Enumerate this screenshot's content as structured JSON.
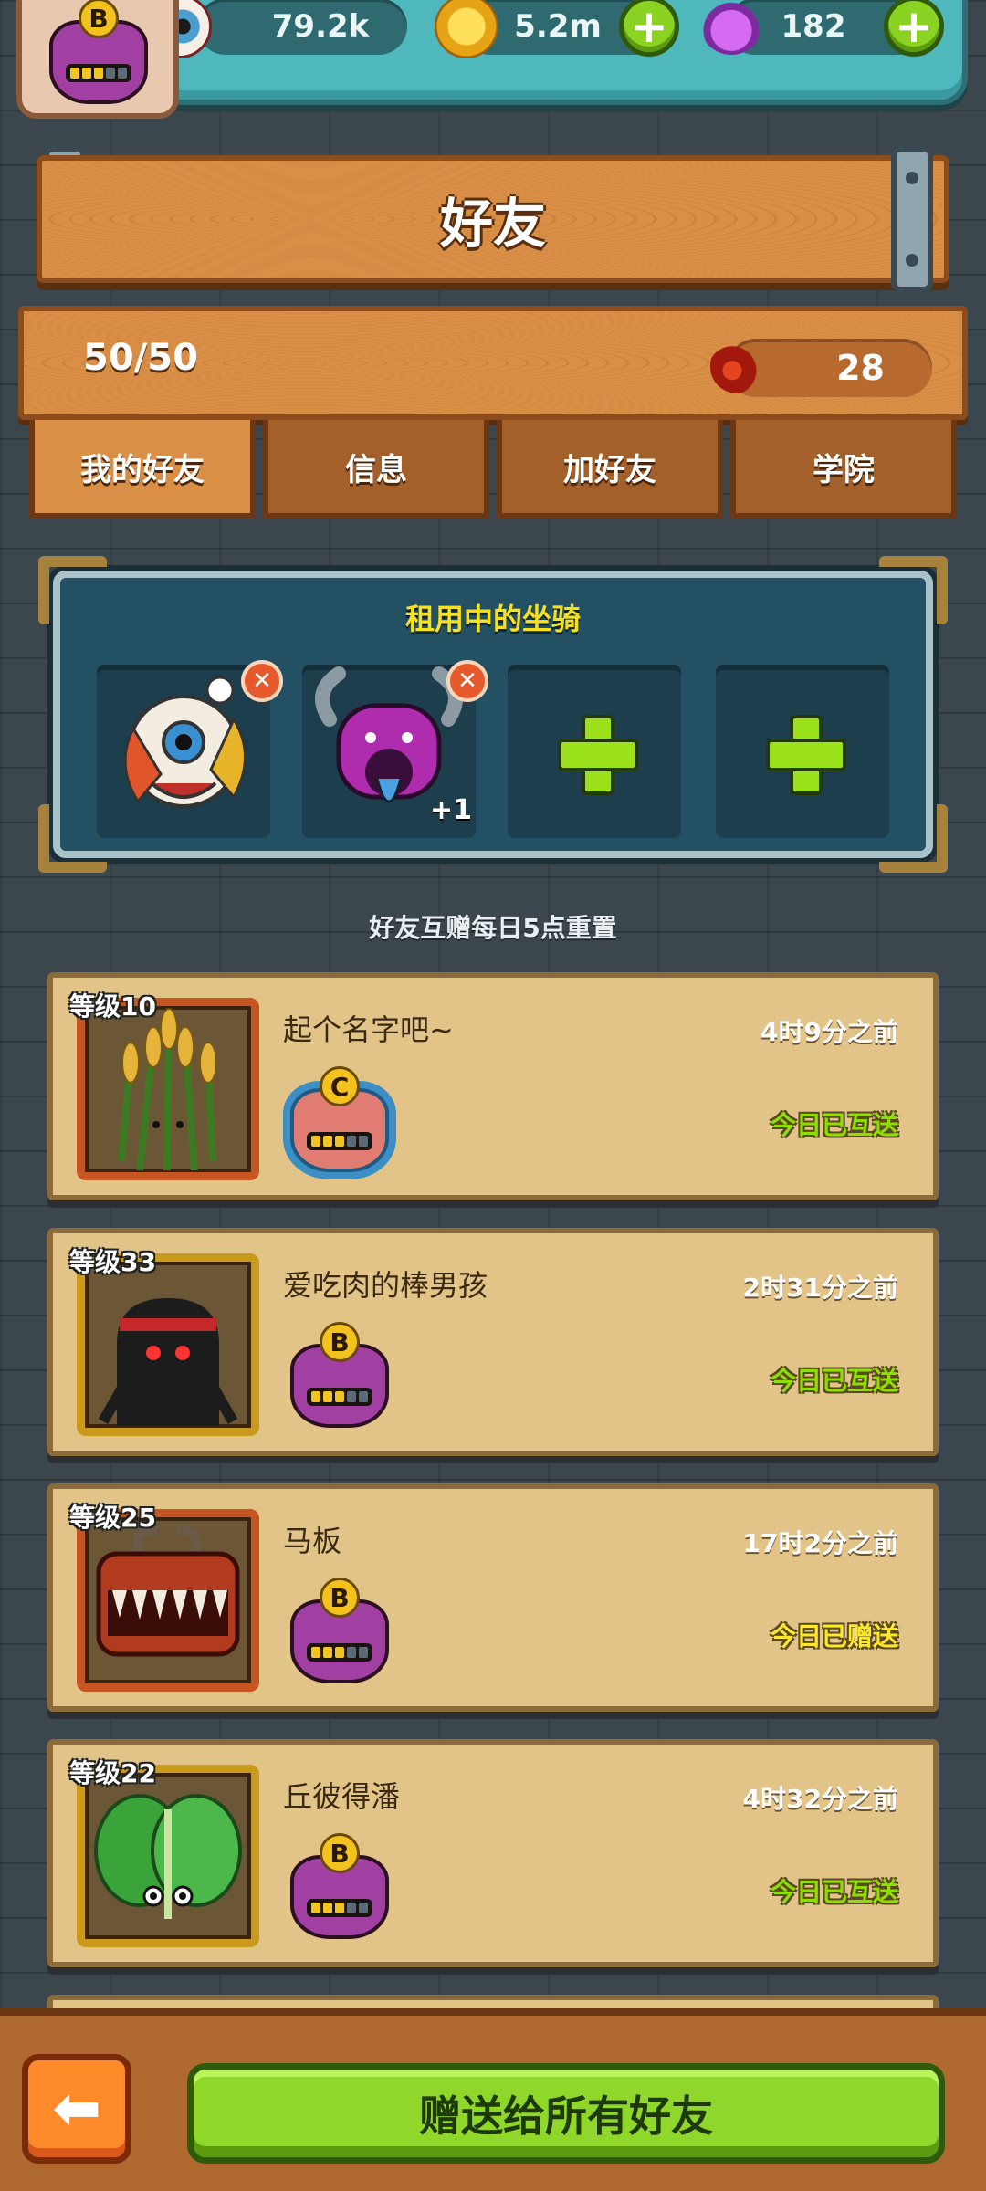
{
  "resources": {
    "eyes": "79.2k",
    "coins": "5.2m",
    "potions": "182"
  },
  "player": {
    "rank": "B"
  },
  "header": {
    "title": "好友"
  },
  "stats": {
    "friend_count": "50/50",
    "blood": "28"
  },
  "tabs": [
    {
      "label": "我的好友",
      "active": true
    },
    {
      "label": "信息",
      "active": false
    },
    {
      "label": "加好友",
      "active": false
    },
    {
      "label": "学院",
      "active": false
    }
  ],
  "mounts": {
    "title": "租用中的坐骑",
    "slots": [
      {
        "filled": true,
        "icon": "lion-dance-mount-icon"
      },
      {
        "filled": true,
        "icon": "purple-monster-mount-icon",
        "bonus": "+1"
      },
      {
        "filled": false
      },
      {
        "filled": false
      }
    ]
  },
  "reset_note": "好友互赠每日5点重置",
  "friends": [
    {
      "level": "等级10",
      "name": "起个名字吧~",
      "last_seen": "4时9分之前",
      "status": "今日已互送",
      "rank": "C",
      "avatar": "wheat-monster-icon"
    },
    {
      "level": "等级33",
      "name": "爱吃肉的棒男孩",
      "last_seen": "2时31分之前",
      "status": "今日已互送",
      "rank": "B",
      "avatar": "black-ninja-monster-icon"
    },
    {
      "level": "等级25",
      "name": "马板",
      "last_seen": "17时2分之前",
      "status": "今日已赠送",
      "rank": "B",
      "avatar": "red-horned-monster-icon"
    },
    {
      "level": "等级22",
      "name": "丘彼得潘",
      "last_seen": "4时32分之前",
      "status": "今日已互送",
      "rank": "B",
      "avatar": "lettuce-monster-icon"
    }
  ],
  "colors": {
    "status_mutual": "#8fe000",
    "status_sent": "#ffe82a"
  },
  "footer": {
    "back_icon": "left-arrow-icon",
    "gift_all_label": "赠送给所有好友"
  }
}
